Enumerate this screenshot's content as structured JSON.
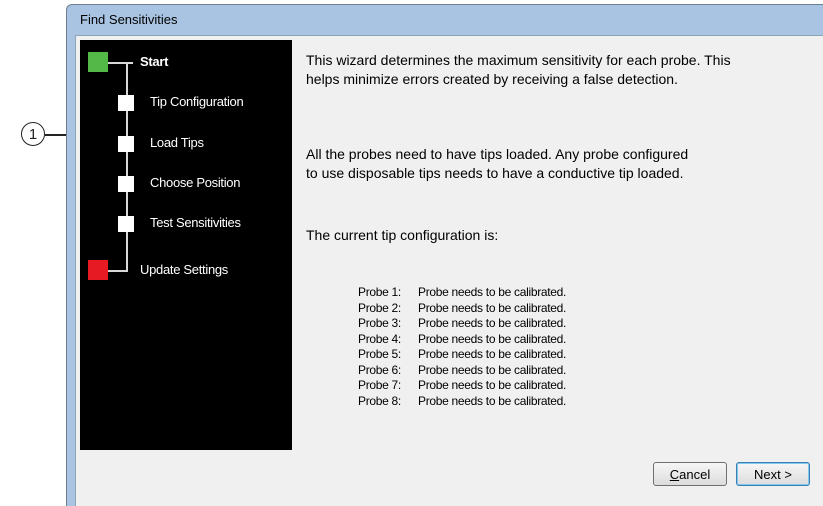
{
  "callout": {
    "number": "1"
  },
  "window": {
    "title": "Find Sensitivities"
  },
  "steps": [
    {
      "label": "Start",
      "marker": "green"
    },
    {
      "label": "Tip Configuration",
      "marker": "white"
    },
    {
      "label": "Load Tips",
      "marker": "white"
    },
    {
      "label": "Choose Position",
      "marker": "white"
    },
    {
      "label": "Test Sensitivities",
      "marker": "white"
    },
    {
      "label": "Update Settings",
      "marker": "red"
    }
  ],
  "content": {
    "intro_line1": "This wizard determines the maximum sensitivity for each probe.  This",
    "intro_line2": "helps minimize errors created by receiving a false detection.",
    "tips_line1": "All the probes need to have tips loaded.  Any probe configured",
    "tips_line2": "to use disposable tips needs to have a conductive tip loaded.",
    "config_heading": "The current tip configuration is:",
    "probes": [
      {
        "name": "Probe 1:",
        "status": "Probe needs to be calibrated."
      },
      {
        "name": "Probe 2:",
        "status": "Probe needs to be calibrated."
      },
      {
        "name": "Probe 3:",
        "status": "Probe needs to be calibrated."
      },
      {
        "name": "Probe 4:",
        "status": "Probe needs to be calibrated."
      },
      {
        "name": "Probe 5:",
        "status": "Probe needs to be calibrated."
      },
      {
        "name": "Probe 6:",
        "status": "Probe needs to be calibrated."
      },
      {
        "name": "Probe 7:",
        "status": "Probe needs to be calibrated."
      },
      {
        "name": "Probe 8:",
        "status": "Probe needs to be calibrated."
      }
    ]
  },
  "buttons": {
    "cancel_first": "C",
    "cancel_rest": "ancel",
    "next": "Next >"
  },
  "colors": {
    "start_marker": "#54b848",
    "end_marker": "#e51a22",
    "sidebar_bg": "#000000",
    "titlebar": "#a9c4e2"
  }
}
